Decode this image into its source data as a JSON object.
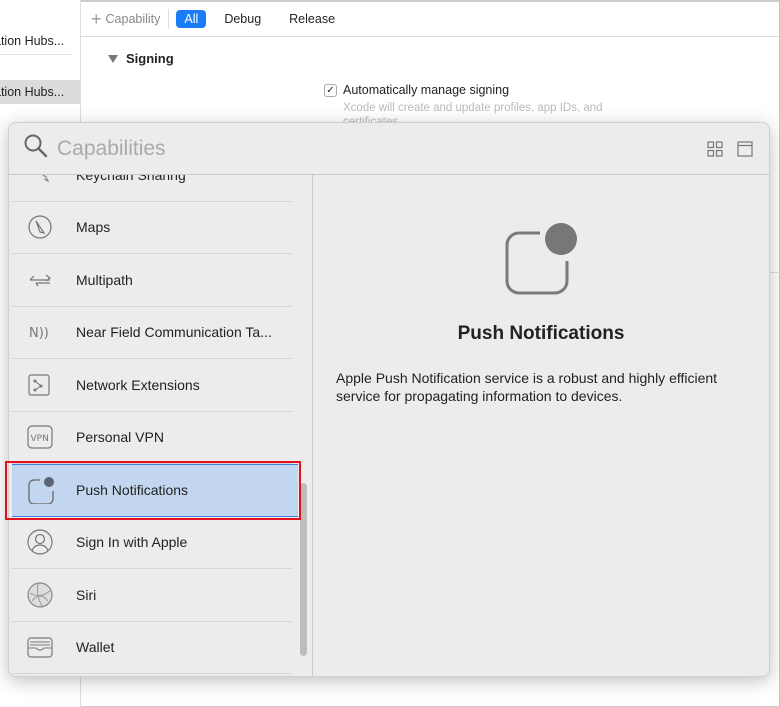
{
  "sidebar": {
    "items": [
      {
        "label": "ation Hubs..."
      },
      {
        "label": "ation Hubs..."
      }
    ]
  },
  "toolbar": {
    "add_capability": "Capability",
    "filters": [
      "All",
      "Debug",
      "Release"
    ],
    "active_filter": "All",
    "accent": "#1a7cf6"
  },
  "signing": {
    "section": "Signing",
    "auto_manage": "Automatically manage signing",
    "auto_manage_checked": true,
    "description": "Xcode will create and update profiles, app IDs, and certificates."
  },
  "popover": {
    "search_placeholder": "Capabilities",
    "view_buttons": [
      "grid-icon",
      "single-view-icon"
    ],
    "items": [
      {
        "label": "Keychain Sharing",
        "icon": "key-icon"
      },
      {
        "label": "Maps",
        "icon": "compass-icon"
      },
      {
        "label": "Multipath",
        "icon": "multipath-arrows-icon"
      },
      {
        "label": "Near Field Communication Ta...",
        "icon": "nfc-icon"
      },
      {
        "label": "Network Extensions",
        "icon": "puzzle-icon"
      },
      {
        "label": "Personal VPN",
        "icon": "vpn-icon"
      },
      {
        "label": "Push Notifications",
        "icon": "notification-badge-icon",
        "selected": true
      },
      {
        "label": "Sign In with Apple",
        "icon": "person-icon"
      },
      {
        "label": "Siri",
        "icon": "siri-icon"
      },
      {
        "label": "Wallet",
        "icon": "wallet-icon"
      }
    ],
    "detail": {
      "title": "Push Notifications",
      "description": "Apple Push Notification service is a robust and highly efficient service for propagating information to devices."
    },
    "highlight_color": "#e3101e",
    "selection_color": "#c2d7ef"
  }
}
